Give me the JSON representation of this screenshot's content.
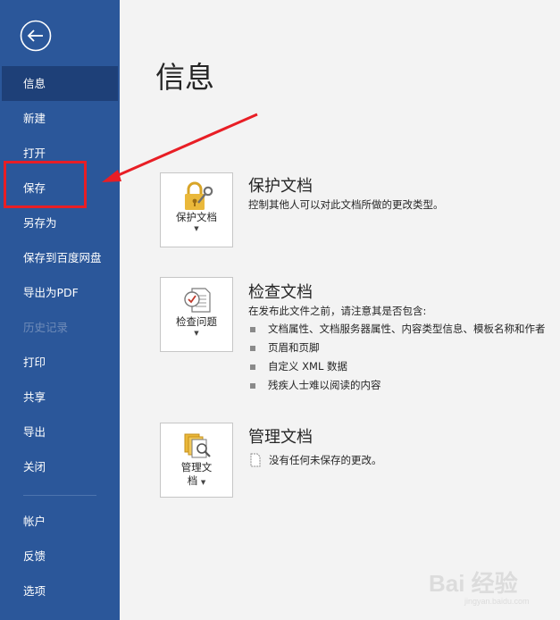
{
  "sidebar": {
    "items": [
      {
        "label": "信息",
        "selected": true
      },
      {
        "label": "新建"
      },
      {
        "label": "打开"
      },
      {
        "label": "保存"
      },
      {
        "label": "另存为"
      },
      {
        "label": "保存到百度网盘"
      },
      {
        "label": "导出为PDF"
      },
      {
        "label": "历史记录",
        "disabled": true
      },
      {
        "label": "打印"
      },
      {
        "label": "共享"
      },
      {
        "label": "导出"
      },
      {
        "label": "关闭"
      },
      {
        "label": "帐户"
      },
      {
        "label": "反馈"
      },
      {
        "label": "选项"
      }
    ]
  },
  "main": {
    "title": "信息",
    "protect": {
      "button_label": "保护文档",
      "title": "保护文档",
      "description": "控制其他人可以对此文档所做的更改类型。"
    },
    "inspect": {
      "button_label": "检查问题",
      "title": "检查文档",
      "description": "在发布此文件之前，请注意其是否包含:",
      "bullets": [
        "文档属性、文档服务器属性、内容类型信息、模板名称和作者",
        "页眉和页脚",
        "自定义 XML 数据",
        "残疾人士难以阅读的内容"
      ]
    },
    "manage": {
      "button_label_line1": "管理文",
      "button_label_line2": "档",
      "title": "管理文档",
      "description": "没有任何未保存的更改。"
    }
  },
  "watermark": {
    "text": "Bai 经验",
    "sub": "jingyan.baidu.com"
  },
  "colors": {
    "sidebar": "#2b579a",
    "selected": "#1e4078",
    "highlight": "#e81e25",
    "background": "#f3f3f3"
  }
}
